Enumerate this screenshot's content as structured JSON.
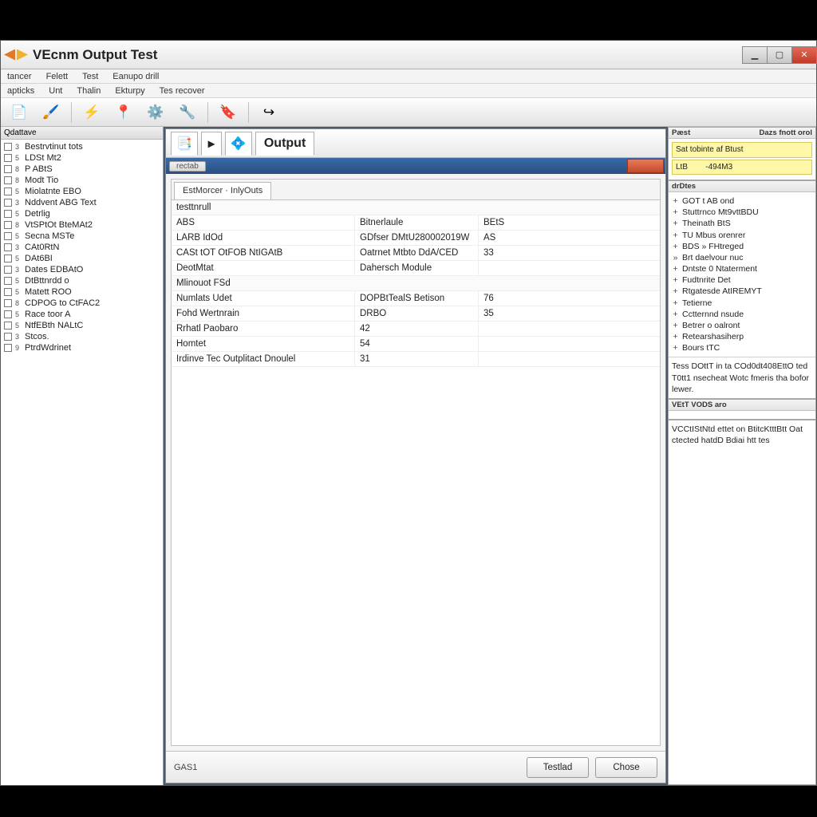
{
  "titlebar": {
    "title": "VEcnm Output Test"
  },
  "menu1": {
    "items": [
      "tancer",
      "Felett",
      "Test",
      "Eanupo drill"
    ]
  },
  "menu2": {
    "items": [
      "apticks",
      "Unt",
      "Thalin",
      "Ekturpy",
      "Tes recover"
    ]
  },
  "toolbar": {
    "icons": [
      "document",
      "brush",
      "bolt",
      "pin",
      "gear",
      "wrench",
      "tag",
      "arrow"
    ]
  },
  "sidebar": {
    "header": "Qdattave",
    "items": [
      {
        "n": "3",
        "label": "Bestrvtinut tots"
      },
      {
        "n": "5",
        "label": "LDSt Mt2"
      },
      {
        "n": "8",
        "label": "P ABtS"
      },
      {
        "n": "8",
        "label": "Modt Tio"
      },
      {
        "n": "5",
        "label": "Miolatnte EBO"
      },
      {
        "n": "3",
        "label": "Nddvent ABG Text"
      },
      {
        "n": "5",
        "label": "Detrlig"
      },
      {
        "n": "8",
        "label": "VtSPtOt BteMAt2"
      },
      {
        "n": "5",
        "label": "Secna MSTe"
      },
      {
        "n": "3",
        "label": "CAt0RtN"
      },
      {
        "n": "5",
        "label": "DAt6BI"
      },
      {
        "n": "3",
        "label": "Dates EDBAtO"
      },
      {
        "n": "5",
        "label": "DtBttnrdd o"
      },
      {
        "n": "5",
        "label": "Matett ROO"
      },
      {
        "n": "8",
        "label": "CDPOG to CtFAC2"
      },
      {
        "n": "5",
        "label": "Race toor A"
      },
      {
        "n": "5",
        "label": "NtfEBth NALtC"
      },
      {
        "n": "3",
        "label": "Stcos."
      },
      {
        "n": "9",
        "label": "PtrdWdrinet"
      }
    ]
  },
  "center": {
    "output_tab": "Output",
    "sub_label": "rectab",
    "tabstrip": "EstMorcer · InlyOuts",
    "sections": [
      {
        "title": "testtnrull",
        "rows": [
          {
            "c1": "ABS",
            "c2": "Bitnerlaule",
            "c3": "BEtS"
          },
          {
            "c1": "LARB IdOd",
            "c2": "GDfser DMtU280002019W",
            "c3": "AS"
          },
          {
            "c1": "CASt tOT OtFOB NtIGAtB",
            "c2": "Oatrnet Mtbto DdA/CED",
            "c3": "33"
          },
          {
            "c1": "DeotMtat",
            "c2": "Dahersch Module",
            "c3": ""
          }
        ]
      },
      {
        "title": "Mlinouot FSd",
        "rows": [
          {
            "c1": "Numlats Udet",
            "c2": "DOPBtTealS Betison",
            "c3": "76"
          },
          {
            "c1": "Fohd Wertnrain",
            "c2": "DRBO",
            "c3": "35"
          },
          {
            "c1": "Rrhatl Paobaro",
            "c2": "42",
            "c3": ""
          },
          {
            "c1": "Homtet",
            "c2": "54",
            "c3": ""
          },
          {
            "c1": "Irdinve Tec Outplitact Dnoulel",
            "c2": "31",
            "c3": ""
          }
        ]
      }
    ],
    "footer": {
      "status": "GAS1",
      "test_btn": "Testlad",
      "close_btn": "Chose"
    }
  },
  "right": {
    "panel1": {
      "hdr_left": "Pæst",
      "hdr_right": "Dazs fnott orol",
      "hl1": "Sat tobinte af Btust",
      "hl2": "LtB        -494M3"
    },
    "panel2": {
      "hdr": "drDtes",
      "items": [
        {
          "p": "+",
          "t": "GOT t AB ond"
        },
        {
          "p": "+",
          "t": "Stuttrnco Mt9vttBDU"
        },
        {
          "p": "+",
          "t": "Theinath BtS"
        },
        {
          "p": "+",
          "t": "TU Mbus orenrer"
        },
        {
          "p": "+",
          "t": "BDS » FHtreged"
        },
        {
          "p": "»",
          "t": "Brt daelvour nuc"
        },
        {
          "p": "+",
          "t": "Dntste 0 Ntaterment"
        },
        {
          "p": "+",
          "t": "Fudtnrite Det"
        },
        {
          "p": "+",
          "t": "Rtgatesde AtIREMYT"
        },
        {
          "p": "+",
          "t": "Tetierne"
        },
        {
          "p": "+",
          "t": "Cctternnd nsude"
        },
        {
          "p": "+",
          "t": "Betrer o oalront"
        },
        {
          "p": "+",
          "t": "Retearshasiherp"
        },
        {
          "p": "+",
          "t": "Bours tTC"
        }
      ],
      "note": "Tess DOttT in ta COd0dt408EttO ted T0tt1 nsecheat Wotc fmeris tha bofor lewer."
    },
    "panel3": {
      "hdr": "VEtT VODS aro"
    },
    "panel4": {
      "text": "VCCtIStNtd ettet on BtitcKtttBtt Oat ctected hatdD Bdiai htt tes"
    }
  },
  "colors": {
    "accent": "#2a4f80",
    "danger": "#c24a2a",
    "highlight": "#fff7a8"
  }
}
